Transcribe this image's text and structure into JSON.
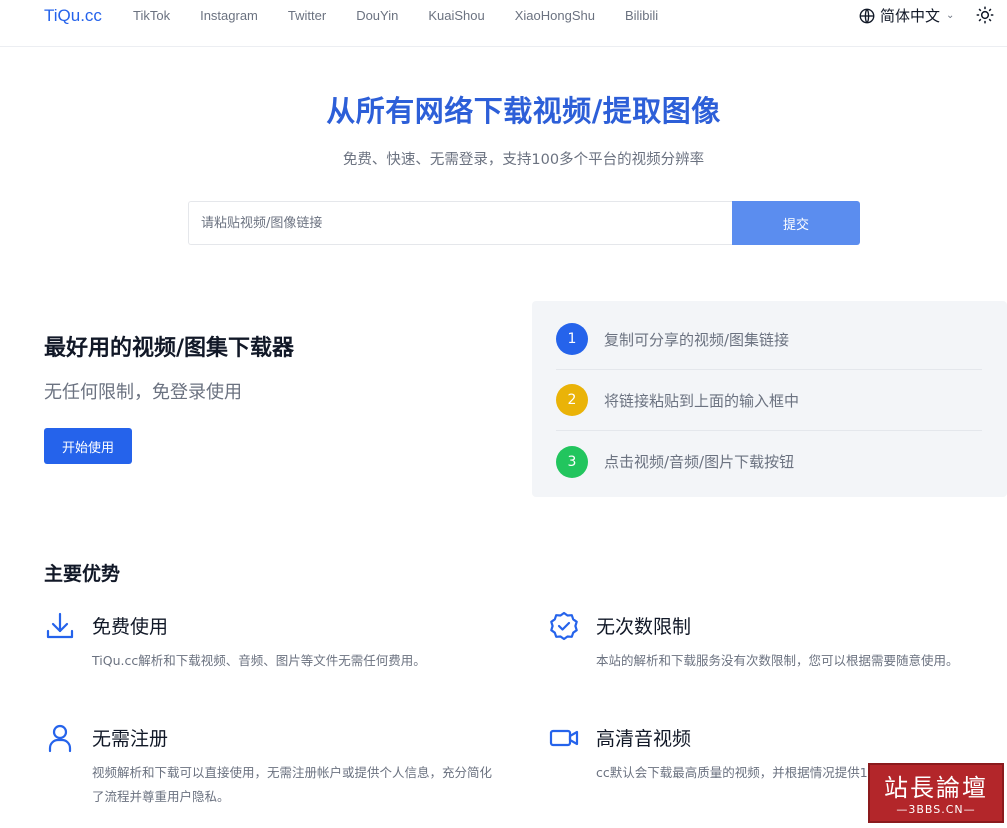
{
  "header": {
    "logo": "TiQu.cc",
    "nav": [
      "TikTok",
      "Instagram",
      "Twitter",
      "DouYin",
      "KuaiShou",
      "XiaoHongShu",
      "Bilibili"
    ],
    "language": "简体中文",
    "icons": {
      "language": "globe-icon",
      "theme": "sun-icon",
      "dropdown": "chevron-down-icon"
    }
  },
  "hero": {
    "title": "从所有网络下载视频/提取图像",
    "subtitle": "免费、快速、无需登录，支持100多个平台的视频分辨率",
    "input_placeholder": "请粘贴视频/图像链接",
    "submit_label": "提交"
  },
  "feature": {
    "title": "最好用的视频/图集下载器",
    "subtitle": "无任何限制，免登录使用",
    "start_label": "开始使用"
  },
  "steps": [
    {
      "num": "1",
      "text": "复制可分享的视频/图集链接",
      "color": "#2563eb"
    },
    {
      "num": "2",
      "text": "将链接粘贴到上面的输入框中",
      "color": "#eab308"
    },
    {
      "num": "3",
      "text": "点击视频/音频/图片下载按钮",
      "color": "#22c55e"
    }
  ],
  "advantages": {
    "heading": "主要优势",
    "items": [
      {
        "icon": "download-icon",
        "title": "免费使用",
        "desc": "TiQu.cc解析和下载视频、音频、图片等文件无需任何费用。"
      },
      {
        "icon": "verified-badge-icon",
        "title": "无次数限制",
        "desc": "本站的解析和下载服务没有次数限制，您可以根据需要随意使用。"
      },
      {
        "icon": "user-icon",
        "title": "无需注册",
        "desc": "视频解析和下载可以直接使用，无需注册帐户或提供个人信息，充分简化了流程并尊重用户隐私。"
      },
      {
        "icon": "video-camera-icon",
        "title": "高清音视频",
        "desc": "cc默认会下载最高质量的视频，并根据情况提供1080P、2K、4K等选择。"
      }
    ]
  },
  "watermark": {
    "top": "站長論壇",
    "bottom": "—3BBS.CN—"
  },
  "colors": {
    "accent": "#2563eb",
    "title_blue": "#2d5fd8",
    "submit": "#5b8def"
  }
}
